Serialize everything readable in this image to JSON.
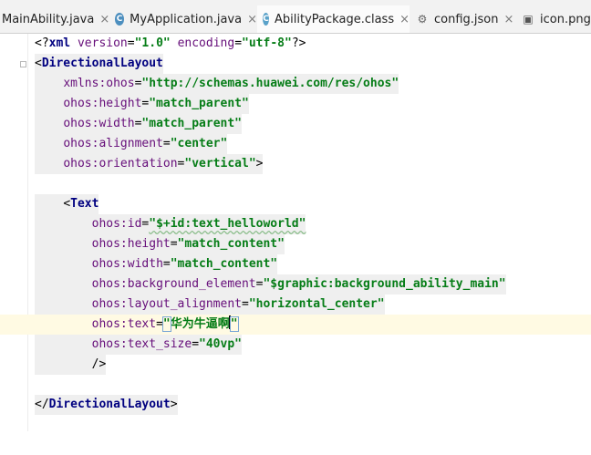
{
  "tabs": [
    {
      "label": "MainAbility.java",
      "icon": "java-file-icon",
      "active": false
    },
    {
      "label": "MyApplication.java",
      "icon": "class-c-icon",
      "active": false
    },
    {
      "label": "AbilityPackage.class",
      "icon": "class-c-icon",
      "active": true
    },
    {
      "label": "config.json",
      "icon": "config-json-icon",
      "active": false
    },
    {
      "label": "icon.png",
      "icon": "image-icon",
      "active": false
    }
  ],
  "tab_close_glyph": "×",
  "colors": {
    "tag": "#000080",
    "attribute": "#660e7a",
    "value": "#067d17",
    "current_line": "#fffae3"
  },
  "code": {
    "l1": {
      "a": "<?",
      "b": "xml ",
      "c": "version",
      "d": "=",
      "e": "\"1.0\"",
      "f": " ",
      "g": "encoding",
      "h": "=",
      "i": "\"utf-8\"",
      "j": "?>"
    },
    "l2": {
      "open": "<",
      "tag": "DirectionalLayout"
    },
    "l3": {
      "indent": "    ",
      "attr": "xmlns:ohos",
      "eq": "=",
      "val": "\"http://schemas.huawei.com/res/ohos\""
    },
    "l4": {
      "indent": "    ",
      "attr": "ohos:height",
      "eq": "=",
      "val": "\"match_parent\""
    },
    "l5": {
      "indent": "    ",
      "attr": "ohos:width",
      "eq": "=",
      "val": "\"match_parent\""
    },
    "l6": {
      "indent": "    ",
      "attr": "ohos:alignment",
      "eq": "=",
      "val": "\"center\""
    },
    "l7": {
      "indent": "    ",
      "attr": "ohos:orientation",
      "eq": "=",
      "val": "\"vertical\"",
      "close": ">"
    },
    "l9": {
      "indent": "    ",
      "open": "<",
      "tag": "Text"
    },
    "l10": {
      "indent": "        ",
      "attr": "ohos:id",
      "eq": "=",
      "val": "\"$+id:text_helloworld\""
    },
    "l11": {
      "indent": "        ",
      "attr": "ohos:height",
      "eq": "=",
      "val": "\"match_content\""
    },
    "l12": {
      "indent": "        ",
      "attr": "ohos:width",
      "eq": "=",
      "val": "\"match_content\""
    },
    "l13": {
      "indent": "        ",
      "attr": "ohos:background_element",
      "eq": "=",
      "val": "\"$graphic:background_ability_main\""
    },
    "l14": {
      "indent": "        ",
      "attr": "ohos:layout_alignment",
      "eq": "=",
      "val": "\"horizontal_center\""
    },
    "l15": {
      "indent": "        ",
      "attr": "ohos:text",
      "eq": "=",
      "q1": "\"",
      "cn": "华为牛逼啊",
      "q2": "\""
    },
    "l16": {
      "indent": "        ",
      "attr": "ohos:text_size",
      "eq": "=",
      "val": "\"40vp\""
    },
    "l17": {
      "indent": "        ",
      "close": "/>"
    },
    "l19": {
      "open": "</",
      "tag": "DirectionalLayout",
      "close": ">"
    }
  }
}
